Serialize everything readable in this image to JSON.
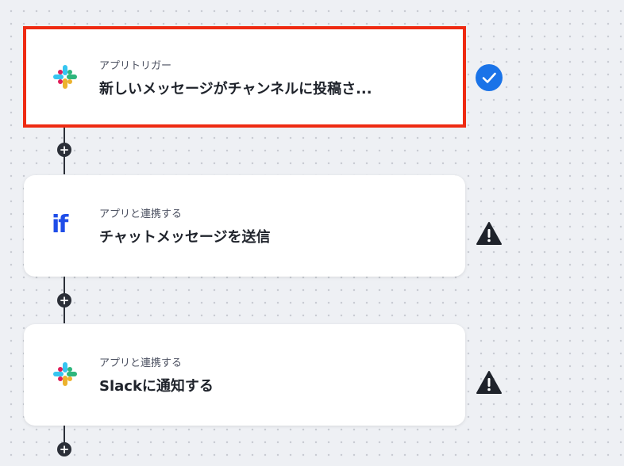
{
  "steps": [
    {
      "subtitle": "アプリトリガー",
      "title": "新しいメッセージがチャンネルに投稿さ...",
      "icon": "slack-icon",
      "status": "check-circle-icon",
      "selected": true
    },
    {
      "subtitle": "アプリと連携する",
      "title": "チャットメッセージを送信",
      "icon": "if-logo-icon",
      "logo_text": "if",
      "status": "warning-icon"
    },
    {
      "subtitle": "アプリと連携する",
      "title": "Slackに通知する",
      "icon": "slack-icon",
      "status": "warning-icon"
    }
  ],
  "add_step_symbol": "+",
  "colors": {
    "accent": "#1a73e8",
    "selected_border": "#ee2a12",
    "if_logo": "#1f4de8"
  }
}
